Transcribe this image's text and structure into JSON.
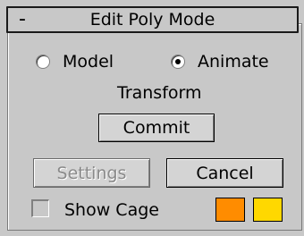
{
  "rollout": {
    "title": "Edit Poly Mode",
    "collapse_symbol": "-"
  },
  "mode": {
    "options": [
      {
        "label": "Model",
        "selected": false
      },
      {
        "label": "Animate",
        "selected": true
      }
    ]
  },
  "transform": {
    "label": "Transform",
    "commit_label": "Commit"
  },
  "actions": {
    "settings_label": "Settings",
    "cancel_label": "Cancel"
  },
  "cage": {
    "show_cage_label": "Show Cage",
    "checked": false,
    "colors": [
      "#ff8c00",
      "#ffd800"
    ]
  }
}
